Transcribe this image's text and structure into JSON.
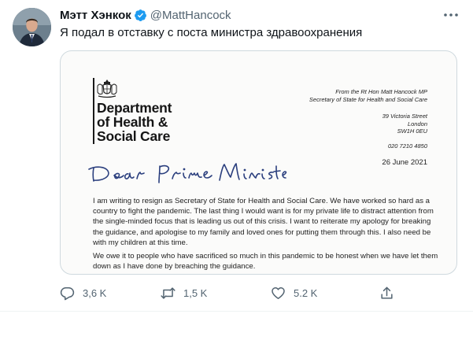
{
  "author": {
    "display_name": "Мэтт Хэнкок",
    "handle": "@MattHancock",
    "separator": "·",
    "verified_icon": "verified-badge-icon"
  },
  "tweet": {
    "text": "Я подал в отставку с поста министра здравоохранения"
  },
  "letter": {
    "department_lines": [
      "Department",
      "of Health &",
      "Social Care"
    ],
    "from_lines": [
      "From the Rt Hon Matt Hancock MP",
      "Secretary of State for Health and Social Care"
    ],
    "address_lines": [
      "39 Victoria Street",
      "London",
      "SW1H 0EU"
    ],
    "phone": "020 7210 4850",
    "date": "26 June 2021",
    "salutation": "Dear Prime Minister",
    "paragraph1": "I am writing to resign as Secretary of State for Health and Social Care. We have worked so hard as a country to fight the pandemic. The last thing I would want is for my private life to distract attention from the single-minded focus that is leading us out of this crisis. I want to reiterate my apology for breaking the guidance, and apologise to my family and loved ones for putting them through this. I also need be with my children at this time.",
    "paragraph2": "We owe it to people who have sacrificed so much in this pandemic to be honest when we have let them down as I have done by breaching the guidance."
  },
  "actions": {
    "reply_count": "3,6 K",
    "retweet_count": "1,5 K",
    "like_count": "5.2 K"
  },
  "colors": {
    "text_primary": "#0f1419",
    "text_secondary": "#536471",
    "verified_blue": "#1d9bf0",
    "border": "#cfd9de"
  }
}
